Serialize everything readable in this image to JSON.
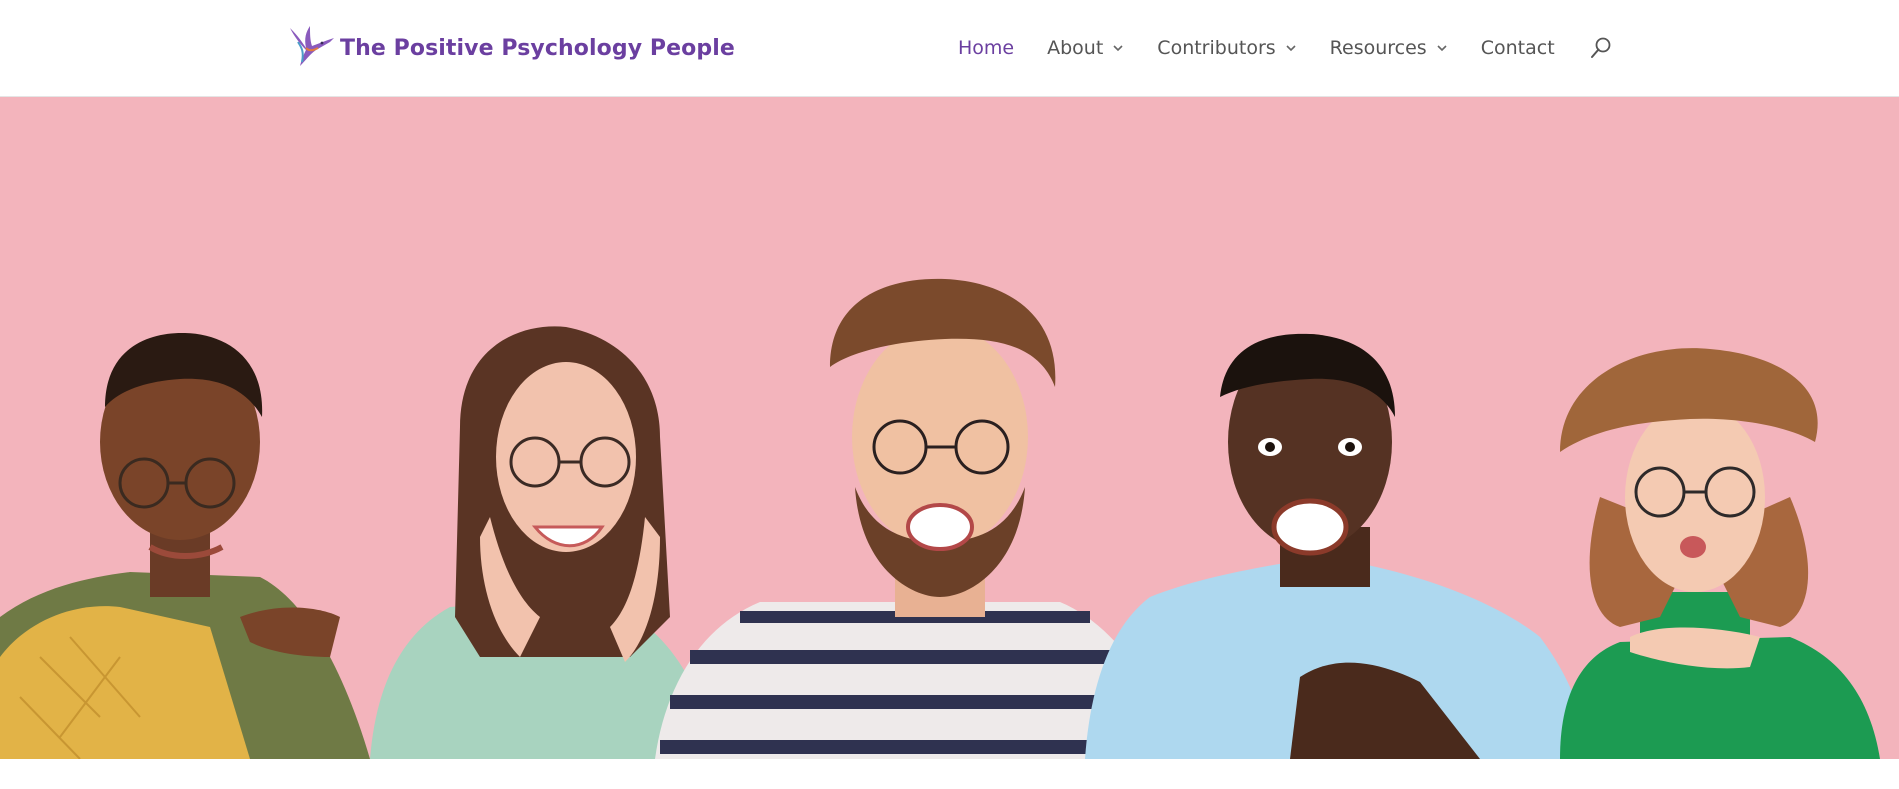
{
  "brand": {
    "name": "The Positive Psychology People",
    "logo_icon": "hummingbird-icon",
    "color": "#6b3fa0"
  },
  "nav": {
    "items": [
      {
        "label": "Home",
        "active": true,
        "dropdown": false
      },
      {
        "label": "About",
        "active": false,
        "dropdown": true
      },
      {
        "label": "Contributors",
        "active": false,
        "dropdown": true
      },
      {
        "label": "Resources",
        "active": false,
        "dropdown": true
      },
      {
        "label": "Contact",
        "active": false,
        "dropdown": false
      }
    ],
    "search_icon": "search-icon"
  },
  "hero": {
    "background_color": "#f3b4bc",
    "image_description_icon": "group-of-five-smiling-people-image"
  }
}
